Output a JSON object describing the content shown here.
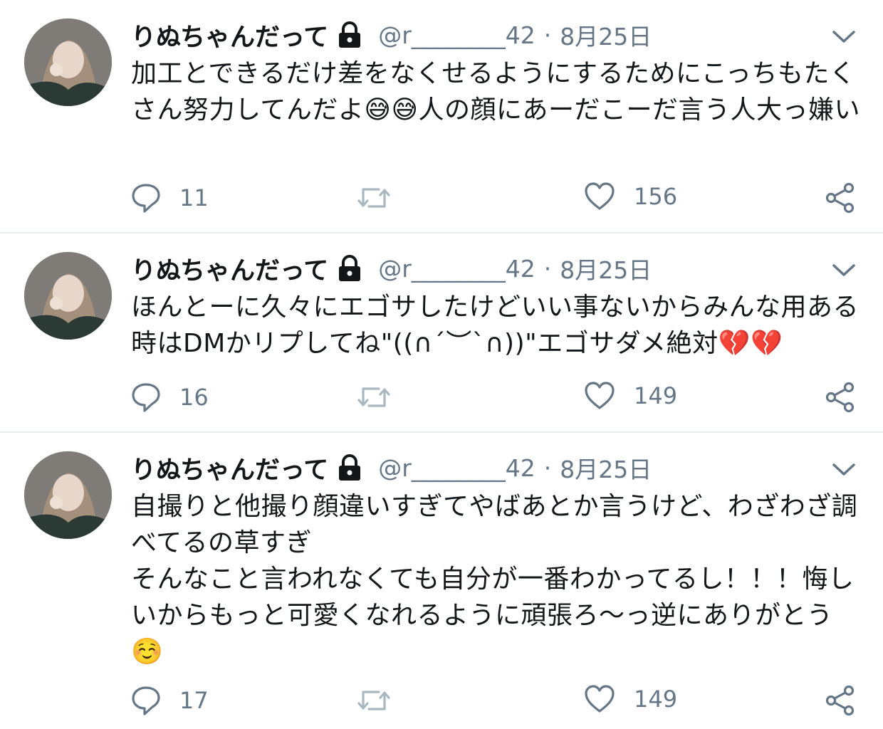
{
  "tweets": [
    {
      "name": "りぬちゃんだって",
      "handle": "@r________42",
      "separator": "·",
      "date": "8月25日",
      "text": "加工とできるだけ差をなくせるようにするためにこっちもたくさん努力してんだよ😅😅人の顔にあーだこーだ言う人大っ嫌い",
      "reply_count": "11",
      "like_count": "156"
    },
    {
      "name": "りぬちゃんだって",
      "handle": "@r________42",
      "separator": "·",
      "date": "8月25日",
      "text": "ほんとーに久々にエゴサしたけどいい事ないからみんな用ある時はDMかリプしてね\"((∩´︶`∩))\"エゴサダメ絶対💔💔",
      "reply_count": "16",
      "like_count": "149"
    },
    {
      "name": "りぬちゃんだって",
      "handle": "@r________42",
      "separator": "·",
      "date": "8月25日",
      "text": "自撮りと他撮り顔違いすぎてやばあとか言うけど、わざわざ調べてるの草すぎ\nそんなこと言われなくても自分が一番わかってるし！！！悔しいからもっと可愛くなれるように頑張ろ〜っ逆にありがとう☺️",
      "reply_count": "17",
      "like_count": "149"
    }
  ],
  "icons": [
    "lock-icon",
    "chevron-down-icon",
    "reply-icon",
    "retweet-icon",
    "like-icon",
    "share-icon"
  ],
  "colors": {
    "text": "#14171a",
    "secondary": "#657786",
    "divider": "#e6ecf0"
  }
}
